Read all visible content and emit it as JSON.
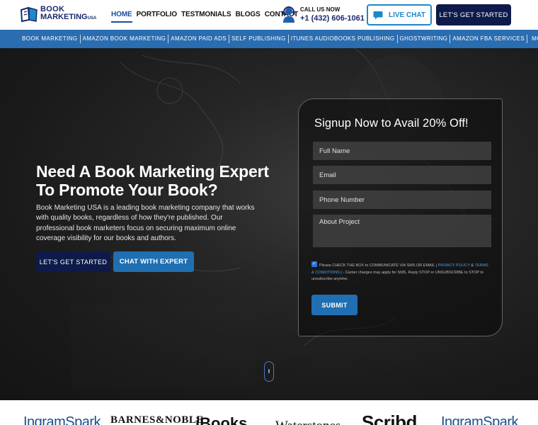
{
  "header": {
    "logo_line1": "BOOK",
    "logo_line2": "MARKETING",
    "logo_suffix": "USA",
    "nav": [
      {
        "label": "HOME",
        "active": true
      },
      {
        "label": "PORTFOLIO"
      },
      {
        "label": "TESTMONIALS"
      },
      {
        "label": "BLOGS"
      },
      {
        "label": "CONTACT"
      }
    ],
    "call_label": "CALL US NOW",
    "call_number": "+1 (432) 606-1061",
    "live_chat_label": "LIVE CHAT",
    "start_label": "LET'S GET STARTED"
  },
  "subnav": {
    "items": [
      "BOOK MARKETING",
      "AMAZON BOOK MARKETING",
      "AMAZON PAID ADS",
      "SELF PUBLISHING",
      "ITUNES AUDIOBOOKS PUBLISHING",
      "GHOSTWRITING",
      "AMAZON FBA SERVICES",
      "MORE"
    ]
  },
  "hero": {
    "title": "Need A Book Marketing Expert To Promote Your Book?",
    "description": "Book Marketing USA is a leading book marketing company that works with quality books, regardless of how they're published. Our professional book marketers focus on securing maximum online coverage visibility for our books and authors.",
    "btn_start": "LET'S GET STARTED",
    "btn_chat": "CHAT WITH EXPERT"
  },
  "form": {
    "title": "Signup Now to Avail 20% Off!",
    "name_placeholder": "Full Name",
    "email_placeholder": "Email",
    "phone_placeholder": "Phone Number",
    "project_placeholder": "About Project",
    "consent_text": "Please CHECK THE BOX to COMMUNICATE VIA SMS OR EMAIL",
    "privacy_link": "PRIVACY POLICY",
    "amp": "&",
    "terms_link": "TERMS & CONDITIONS",
    "consent_tail": "| - Carrier charges may apply for SMS. Reply STOP or UNSUBSCRIBE to STOP to unsubscribe anytime.",
    "submit_label": "SUBMIT"
  },
  "logos": [
    "IngramSpark",
    "BARNES&NOBLE",
    "iBooks",
    "Waterstones",
    "Scribd",
    "IngramSpark"
  ],
  "colors": {
    "brand_navy": "#0d1a4a",
    "accent_blue": "#1f6fb2",
    "subnav_blue": "#2a6db0"
  }
}
